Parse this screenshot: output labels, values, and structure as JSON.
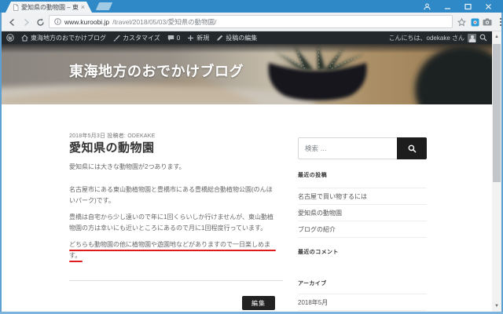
{
  "browser": {
    "tab": {
      "title": "愛知県の動物園 – 東海地"
    },
    "url": {
      "host": "www.kuroobi.jp",
      "path": "/travel/2018/05/03/愛知県の動物園/"
    }
  },
  "admin_bar": {
    "site_name": "東海地方のおでかけブログ",
    "customize_label": "カスタマイズ",
    "comment_count": "0",
    "new_label": "新規",
    "edit_post_label": "投稿の編集",
    "greeting": "こんにちは、odekake さん"
  },
  "site_header": {
    "title": "東海地方のおでかけブログ"
  },
  "article": {
    "date": "2018年5月3日",
    "author_label": "投稿者:",
    "author": "ODEKAKE",
    "title": "愛知県の動物園",
    "paragraphs": [
      "愛知県には大きな動物園が2つあります。",
      "名古屋市にある東山動植物園と豊橋市にある豊橋総合動植物公園(のんほいパーク)です。",
      "豊橋は自宅から少し遠いので年に1回くらいしか行けませんが、東山動植物園の方は幸いにも近いところにあるので月に1回程度行っています。",
      "どちらも動物園の他に植物園や遊園地などがありますので一日楽しめます。"
    ],
    "edit_button_label": "編集"
  },
  "sidebar": {
    "search_placeholder": "検索 …",
    "recent_posts": {
      "title": "最近の投稿",
      "items": [
        "名古屋で買い物するには",
        "愛知県の動物園",
        "ブログの紹介"
      ]
    },
    "recent_comments": {
      "title": "最近のコメント"
    },
    "archives": {
      "title": "アーカイブ",
      "items": [
        "2018年5月"
      ]
    }
  },
  "icons": {
    "page-favicon-icon": "document outline",
    "tab-close-icon": "×",
    "profile-icon": "person silhouette",
    "minimize-icon": "–",
    "maximize-icon": "□",
    "close-icon": "×",
    "back-icon": "left arrow",
    "forward-icon": "right arrow",
    "reload-icon": "circular arrow",
    "info-icon": "ⓘ",
    "bookmark-star-icon": "☆",
    "extension-icon": "teal square",
    "camera-icon": "camera",
    "menu-icon": "⋮",
    "wordpress-logo-icon": "W in circle",
    "home-icon": "house",
    "customize-icon": "paintbrush",
    "comments-icon": "speech bubble",
    "plus-icon": "+",
    "pencil-icon": "pencil",
    "search-icon": "magnifying glass"
  },
  "colors": {
    "titlebar_blue": "#2f89c6",
    "admin_bar_dark": "#23282d",
    "accent_black": "#222222",
    "annotation_red": "#e01b1b",
    "body_text": "#666666"
  }
}
